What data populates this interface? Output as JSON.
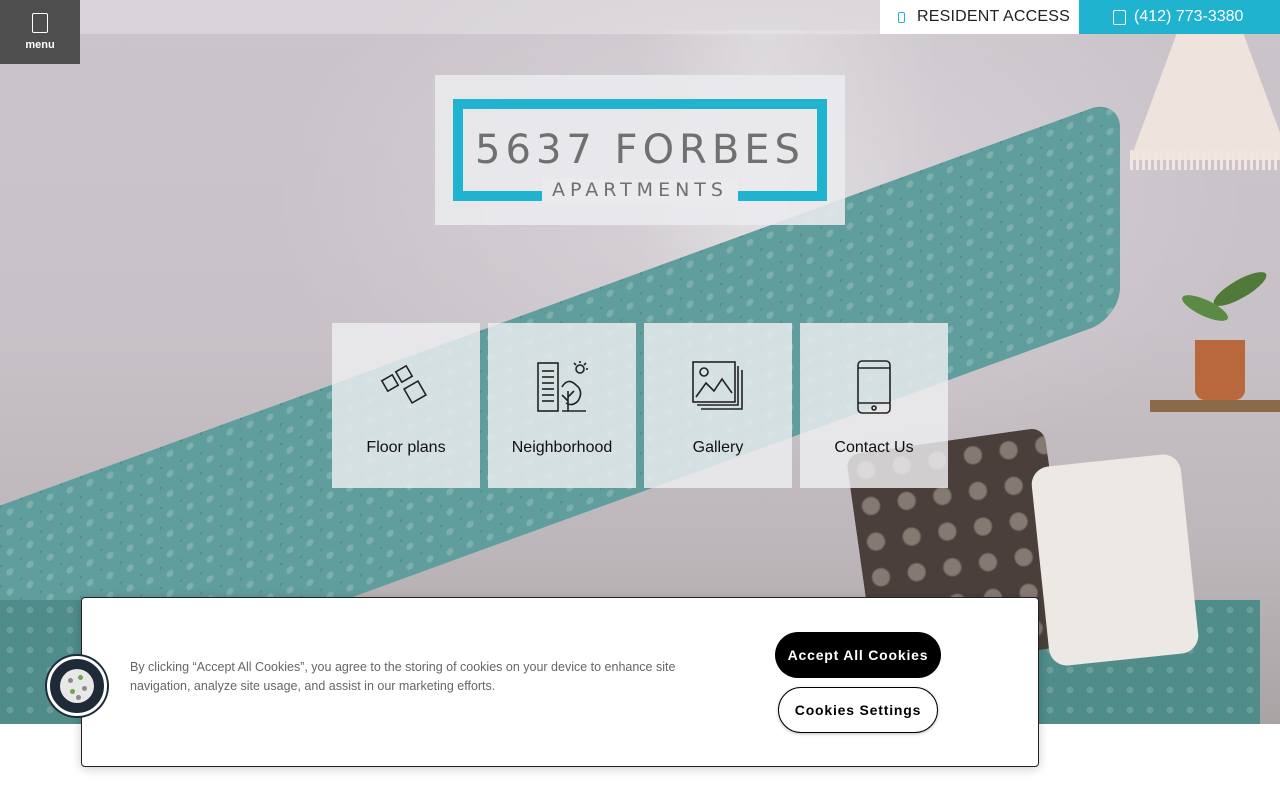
{
  "header": {
    "menu_label": "menu",
    "resident_access": "RESIDENT ACCESS",
    "phone": "(412) 773-3380",
    "accent_color": "#1fb3d0"
  },
  "logo": {
    "title": "5637 FORBES",
    "subtitle": "APARTMENTS"
  },
  "nav_tiles": [
    {
      "label": "Floor plans",
      "icon": "floor-plans-icon"
    },
    {
      "label": "Neighborhood",
      "icon": "neighborhood-icon"
    },
    {
      "label": "Gallery",
      "icon": "gallery-icon"
    },
    {
      "label": "Contact Us",
      "icon": "contact-icon"
    }
  ],
  "cookie_banner": {
    "text": "By clicking “Accept All Cookies”, you agree to the storing of cookies on your device to enhance site navigation, analyze site usage, and assist in our marketing efforts.",
    "accept_label": "Accept All Cookies",
    "settings_label": "Cookies Settings"
  }
}
